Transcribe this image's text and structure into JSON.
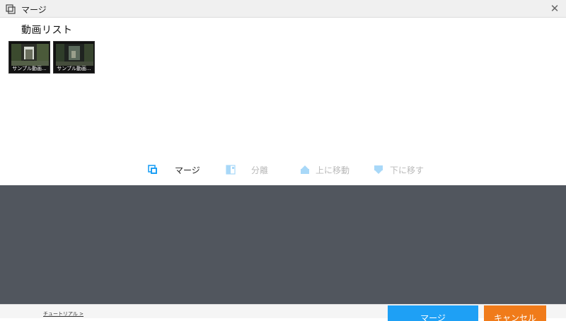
{
  "window": {
    "title": "マージ",
    "icon": "merge-icon",
    "close_icon": "close-icon",
    "close_glyph": "✕"
  },
  "video_list": {
    "title": "動画リスト",
    "items": [
      {
        "caption": "サンプル動画..."
      },
      {
        "caption": "サンプル動画..."
      }
    ]
  },
  "toolbar": {
    "merge_label": "マージ",
    "split_label": "分離",
    "move_up_label": "上に移動",
    "move_down_label": "下に移す"
  },
  "footer": {
    "tutorial_link": "チュートリアル >",
    "merge_button": "マージ",
    "cancel_button": "キャンセル"
  },
  "colors": {
    "accent": "#1ea0f5",
    "cancel": "#f07b1a",
    "preview_bg": "#51565e",
    "disabled_icon": "#a8d8f8"
  }
}
